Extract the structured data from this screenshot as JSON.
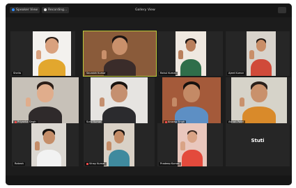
{
  "topbar": {
    "speaker_view_label": "Speaker View",
    "recording_label": "Recording...",
    "meeting_title": "Gallery View"
  },
  "participants": [
    {
      "name": "Sheila",
      "bg": "#f3f1ee",
      "skin": "#d9a17e",
      "shirt": "#e2a72e",
      "hair": "#2a1d17"
    },
    {
      "name": "Saurabh Kumar",
      "bg": "#8a5b3a",
      "skin": "#c9906b",
      "shirt": "#3a2c2a",
      "hair": "#1b1412"
    },
    {
      "name": "Rahul Kumar",
      "bg": "#efe8e0",
      "skin": "#b97f5c",
      "shirt": "#2f6e4a",
      "hair": "#1a1412"
    },
    {
      "name": "Ajeet Kumar",
      "bg": "#d8d3cc",
      "skin": "#c98e68",
      "shirt": "#d04a3a",
      "hair": "#1e1714"
    },
    {
      "name": "Priyanka Singh",
      "bg": "#c7c1b8",
      "skin": "#e0ad8c",
      "shirt": "#2f2a2b",
      "hair": "#2b1e18"
    },
    {
      "name": "Sunil Kumar",
      "bg": "#e6e4e1",
      "skin": "#c59070",
      "shirt": "#2b2b2e",
      "hair": "#19130f"
    },
    {
      "name": "Anurag Singh",
      "bg": "#a45a3a",
      "skin": "#c48a66",
      "shirt": "#5d8fc4",
      "hair": "#16110e"
    },
    {
      "name": "Ashish Patel",
      "bg": "#d6d3c9",
      "skin": "#c9916c",
      "shirt": "#d98a2a",
      "hair": "#2a201b"
    },
    {
      "name": "Rakesh",
      "bg": "#dcd8d2",
      "skin": "#c58e69",
      "shirt": "#f2f2f2",
      "hair": "#15100d"
    },
    {
      "name": "Vinay Kumar",
      "bg": "#d9d1c6",
      "skin": "#c48c67",
      "shirt": "#3f8a9e",
      "hair": "#17110e"
    },
    {
      "name": "Pradeep Kumar",
      "bg": "#e9c7bd",
      "skin": "#d9a486",
      "shirt": "#e34a3c",
      "hair": "#3b2a22"
    },
    {
      "name": "Stuti",
      "bg": null
    }
  ]
}
